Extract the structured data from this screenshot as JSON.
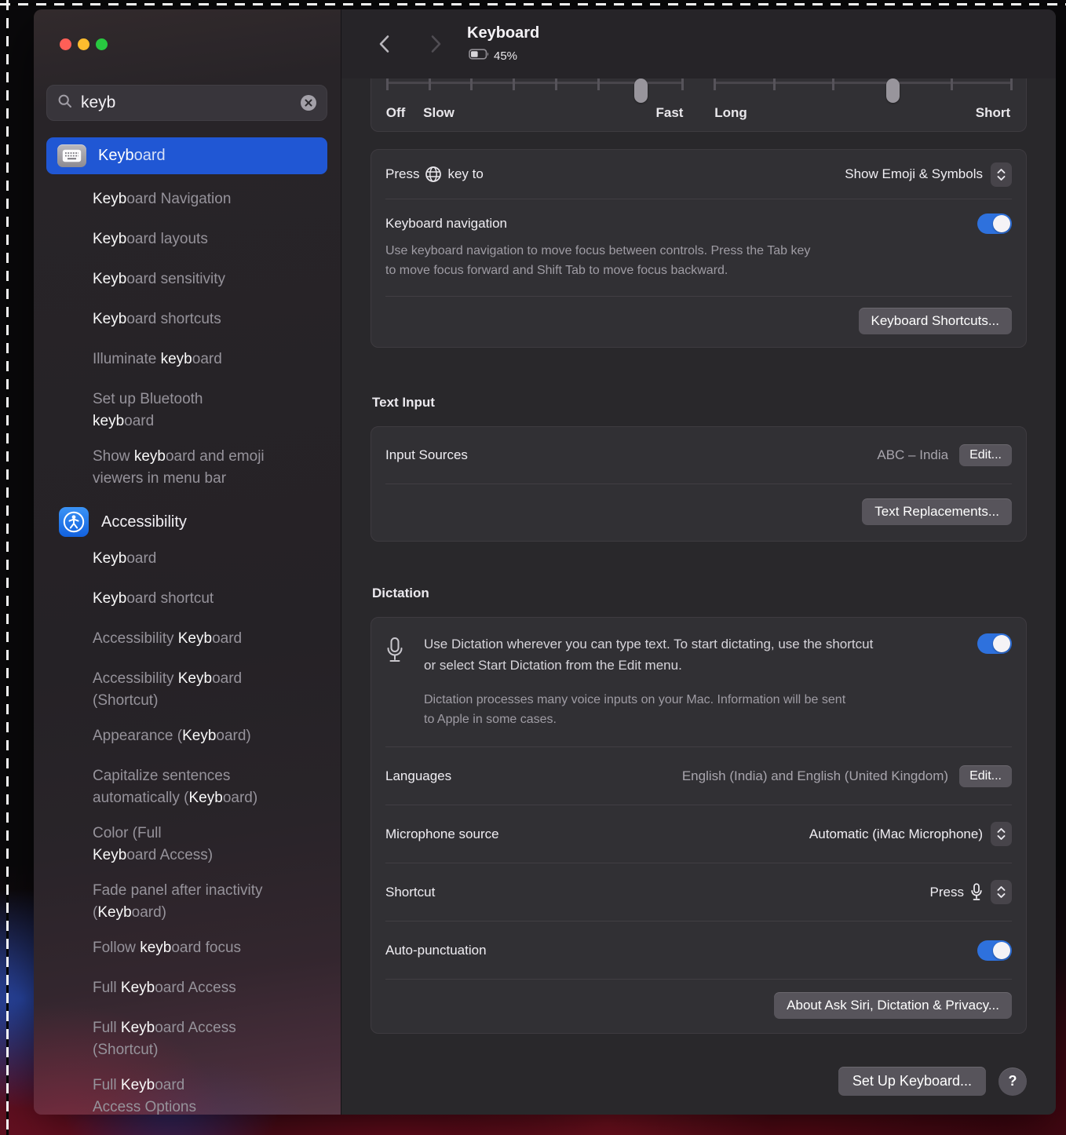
{
  "search": {
    "value": "keyb"
  },
  "header": {
    "title": "Keyboard",
    "battery_percent": "45%"
  },
  "sliders": {
    "labels": {
      "off": "Off",
      "slow": "Slow",
      "fast": "Fast",
      "long": "Long",
      "short": "Short"
    },
    "key_repeat": {
      "ticks": 8,
      "thumb_index": 7
    },
    "delay": {
      "ticks": 6,
      "thumb_index": 4
    }
  },
  "rows": {
    "press_key": {
      "pre": "Press",
      "post": "key to",
      "value": "Show Emoji & Symbols"
    },
    "keyboard_navigation": {
      "label": "Keyboard navigation",
      "enabled": true,
      "description": "Use keyboard navigation to move focus between controls. Press the Tab key\nto move focus forward and Shift Tab to move focus backward."
    },
    "keyboard_shortcuts_button": "Keyboard Shortcuts..."
  },
  "text_input": {
    "heading": "Text Input",
    "input_sources_label": "Input Sources",
    "input_sources_value": "ABC – India",
    "edit_button": "Edit...",
    "text_replacements_button": "Text Replacements..."
  },
  "dictation": {
    "heading": "Dictation",
    "enabled": true,
    "intro": "Use Dictation wherever you can type text. To start dictating, use the shortcut\nor select Start Dictation from the Edit menu.",
    "note": "Dictation processes many voice inputs on your Mac. Information will be sent\nto Apple in some cases.",
    "languages_label": "Languages",
    "languages_value": "English (India) and English (United Kingdom)",
    "languages_edit_button": "Edit...",
    "microphone_label": "Microphone source",
    "microphone_value": "Automatic (iMac Microphone)",
    "shortcut_label": "Shortcut",
    "shortcut_value": "Press",
    "auto_punctuation_label": "Auto-punctuation",
    "auto_punctuation_enabled": true,
    "about_button": "About Ask Siri, Dictation & Privacy..."
  },
  "footer": {
    "setup_button": "Set Up Keyboard...",
    "help_button": "?"
  },
  "sidebar": {
    "items": [
      {
        "pre": "",
        "match": "Keyb",
        "post": "oard",
        "selected": true,
        "icon": "keyboard"
      },
      {
        "pre": "",
        "match": "Keyb",
        "post": "oard Navigation"
      },
      {
        "pre": "",
        "match": "Keyb",
        "post": "oard layouts"
      },
      {
        "pre": "",
        "match": "Keyb",
        "post": "oard sensitivity"
      },
      {
        "pre": "",
        "match": "Keyb",
        "post": "oard shortcuts"
      },
      {
        "pre": "Illuminate ",
        "match": "keyb",
        "post": "oard"
      },
      {
        "pre": "Set up Bluetooth\n",
        "match": "keyb",
        "post": "oard"
      },
      {
        "pre": "Show ",
        "match": "keyb",
        "post": "oard and emoji\nviewers in menu bar"
      },
      {
        "pre": "Accessibility",
        "match": "",
        "post": "",
        "icon": "accessibility"
      },
      {
        "pre": "",
        "match": "Keyb",
        "post": "oard"
      },
      {
        "pre": "",
        "match": "Keyb",
        "post": "oard shortcut"
      },
      {
        "pre": "Accessibility ",
        "match": "Keyb",
        "post": "oard"
      },
      {
        "pre": "Accessibility ",
        "match": "Keyb",
        "post": "oard\n(Shortcut)"
      },
      {
        "pre": "Appearance (",
        "match": "Keyb",
        "post": "oard)"
      },
      {
        "pre": "Capitalize sentences\nautomatically (",
        "match": "Keyb",
        "post": "oard)"
      },
      {
        "pre": "Color (Full\n",
        "match": "Keyb",
        "post": "oard Access)"
      },
      {
        "pre": "Fade panel after inactivity\n(",
        "match": "Keyb",
        "post": "oard)"
      },
      {
        "pre": "Follow ",
        "match": "keyb",
        "post": "oard focus"
      },
      {
        "pre": "Full ",
        "match": "Keyb",
        "post": "oard Access"
      },
      {
        "pre": "Full ",
        "match": "Keyb",
        "post": "oard Access\n(Shortcut)"
      },
      {
        "pre": "Full ",
        "match": "Keyb",
        "post": "oard\nAccess Options"
      }
    ]
  },
  "colors": {
    "selection_blue": "#2057d4",
    "toggle_blue": "#2e71dd",
    "accessibility_icon_blue": "#1261de"
  }
}
